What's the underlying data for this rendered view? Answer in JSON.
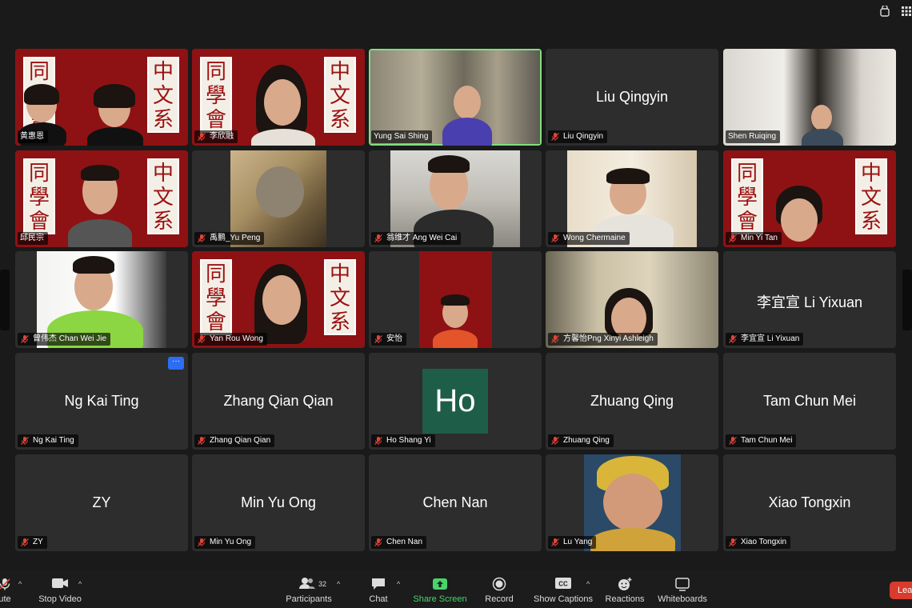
{
  "participants": [
    {
      "name": "黄惠恩",
      "display": "",
      "muted": false
    },
    {
      "name": "李欣融",
      "display": "",
      "muted": true
    },
    {
      "name": "Yung Sai Shing",
      "display": "",
      "muted": false
    },
    {
      "name": "Liu Qingyin",
      "display": "Liu Qingyin",
      "muted": true
    },
    {
      "name": "Shen Ruiqing",
      "display": "",
      "muted": false
    },
    {
      "name": "邱民宗",
      "display": "",
      "muted": false
    },
    {
      "name": "禹鹏_Yu Peng",
      "display": "",
      "muted": true
    },
    {
      "name": "翁维才 Ang Wei Cai",
      "display": "",
      "muted": true
    },
    {
      "name": "Wong Chermaine",
      "display": "",
      "muted": true
    },
    {
      "name": "Min Yi Tan",
      "display": "",
      "muted": true
    },
    {
      "name": "曾伟杰 Chan Wei Jie",
      "display": "",
      "muted": true
    },
    {
      "name": "Yan Rou Wong",
      "display": "",
      "muted": true
    },
    {
      "name": "安怡",
      "display": "",
      "muted": true
    },
    {
      "name": "方馨怡Png Xinyi Ashleigh",
      "display": "",
      "muted": true
    },
    {
      "name": "李宜宣 Li Yixuan",
      "display": "李宜宣 Li Yixuan",
      "muted": true
    },
    {
      "name": "Ng Kai Ting",
      "display": "Ng Kai Ting",
      "muted": true
    },
    {
      "name": "Zhang Qian Qian",
      "display": "Zhang Qian Qian",
      "muted": true
    },
    {
      "name": "Ho Shang Yi",
      "display": "",
      "muted": true
    },
    {
      "name": "Zhuang Qing",
      "display": "Zhuang Qing",
      "muted": true
    },
    {
      "name": "Tam Chun Mei",
      "display": "Tam Chun Mei",
      "muted": true
    },
    {
      "name": "ZY",
      "display": "ZY",
      "muted": true
    },
    {
      "name": "Min Yu Ong",
      "display": "Min Yu Ong",
      "muted": true
    },
    {
      "name": "Chen Nan",
      "display": "Chen Nan",
      "muted": true
    },
    {
      "name": "Lu Yang",
      "display": "",
      "muted": true
    },
    {
      "name": "Xiao Tongxin",
      "display": "Xiao Tongxin",
      "muted": true
    }
  ],
  "avatar_initials": {
    "ho": "Ho"
  },
  "banner_glyphs": {
    "left": [
      "同",
      "學",
      "會"
    ],
    "right": [
      "中",
      "文",
      "系"
    ]
  },
  "more_button": "···",
  "toolbar": {
    "mute": "ute",
    "stop_video": "Stop Video",
    "participants": "Participants",
    "participant_count": "32",
    "chat": "Chat",
    "share_screen": "Share Screen",
    "record": "Record",
    "show_captions": "Show Captions",
    "reactions": "Reactions",
    "whiteboards": "Whiteboards",
    "leave": "Lea"
  },
  "colors": {
    "background": "#1a1a1a",
    "tile": "#2d2d2d",
    "banner_red": "#8e1214",
    "active_speaker": "#7fe07f",
    "share_green": "#48d36b",
    "leave_red": "#d93b2c",
    "avatar_green": "#1e5e48",
    "muted_red": "#e0443a"
  }
}
